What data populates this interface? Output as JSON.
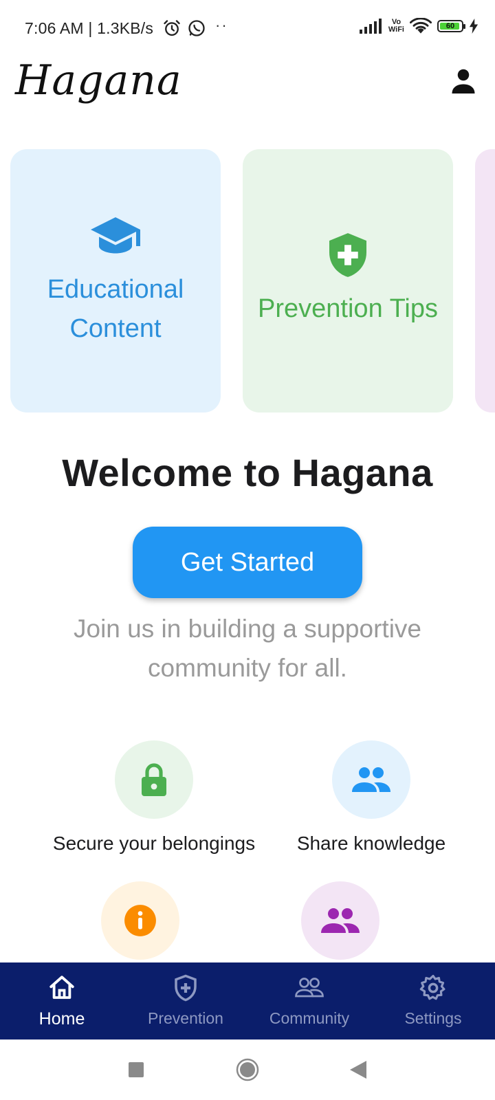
{
  "status_bar": {
    "time": "7:06 AM | 1.3KB/s",
    "dots": "··",
    "vowifi_top": "Vo",
    "vowifi_bottom": "WiFi",
    "battery": "60",
    "icons": [
      "alarm-icon",
      "whatsapp-icon",
      "signal-icon",
      "wifi-icon",
      "battery-icon",
      "charging-icon"
    ]
  },
  "header": {
    "logo": "Hagana",
    "profile_icon": "person-icon"
  },
  "cards": [
    {
      "label": "Educational Content",
      "icon": "graduation-cap-icon",
      "color": "#2b8fdb",
      "bg": "#e3f2fd"
    },
    {
      "label": "Prevention Tips",
      "icon": "shield-plus-icon",
      "color": "#4caf50",
      "bg": "#e8f5e9"
    }
  ],
  "welcome": {
    "title": "Welcome to Hagana",
    "button": "Get Started",
    "tagline": "Join us in building a supportive community for all."
  },
  "features": [
    {
      "label": "Secure your belongings",
      "icon": "lock-icon",
      "color": "#4caf50"
    },
    {
      "label": "Share knowledge",
      "icon": "people-icon",
      "color": "#2196f3"
    },
    {
      "label": "",
      "icon": "info-icon",
      "color": "#fb8c00"
    },
    {
      "label": "",
      "icon": "people-icon",
      "color": "#9c27b0"
    }
  ],
  "bottom_nav": {
    "items": [
      {
        "label": "Home",
        "icon": "home-icon",
        "active": true
      },
      {
        "label": "Prevention",
        "icon": "shield-plus-icon",
        "active": false
      },
      {
        "label": "Community",
        "icon": "people-outline-icon",
        "active": false
      },
      {
        "label": "Settings",
        "icon": "gear-icon",
        "active": false
      }
    ],
    "background": "#0b1e6b"
  },
  "system_nav": {
    "icons": [
      "recents-square-icon",
      "home-circle-icon",
      "back-triangle-icon"
    ]
  },
  "colors": {
    "primary": "#2196f3",
    "green": "#4caf50",
    "nav_bg": "#0b1e6b"
  }
}
